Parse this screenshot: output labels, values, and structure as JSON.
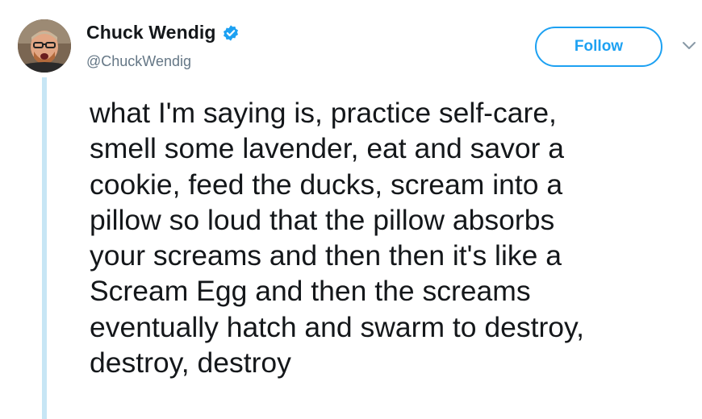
{
  "author": {
    "display_name": "Chuck Wendig",
    "handle": "@ChuckWendig",
    "verified": true
  },
  "actions": {
    "follow_label": "Follow"
  },
  "tweet": {
    "text": "what I'm saying is, practice self-care,\nsmell some lavender, eat and savor a\ncookie, feed the ducks, scream into a\npillow so loud that the pillow absorbs\nyour screams and then then it's like a\nScream Egg and then the screams\neventually hatch and swarm to destroy,\ndestroy, destroy"
  },
  "icons": {
    "verified": "verified-badge-icon",
    "caret": "chevron-down-icon"
  },
  "colors": {
    "accent": "#1da1f2",
    "text": "#14171a",
    "secondary_text": "#657786",
    "thread_line": "#c7e6f5"
  }
}
